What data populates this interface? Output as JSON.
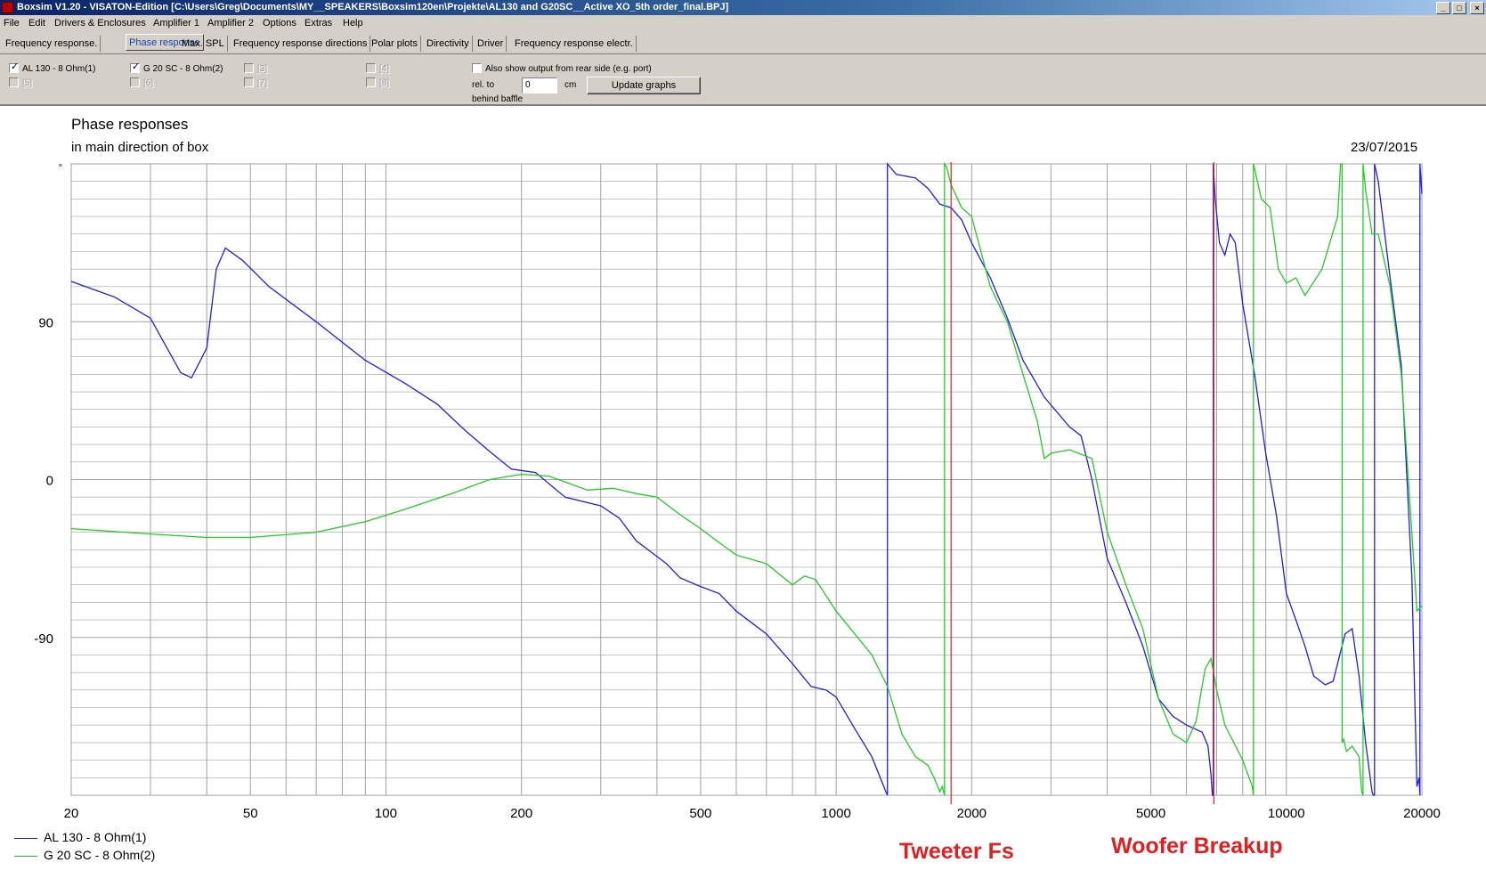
{
  "window": {
    "title": "Boxsim V1.20 - VISATON-Edition [C:\\Users\\Greg\\Documents\\MY__SPEAKERS\\Boxsim120en\\Projekte\\AL130 and G20SC__Active XO_5th order_final.BPJ]",
    "minimize": "_",
    "maximize": "□",
    "close": "×"
  },
  "menu": [
    "File",
    "Edit",
    "Drivers & Enclosures",
    "Amplifier 1",
    "Amplifier 2",
    "Options",
    "Extras",
    "Help"
  ],
  "tabs": [
    "Frequency response.",
    "Phase response",
    "Max. SPL",
    "Frequency response directions",
    "Polar plots",
    "Directivity",
    "Driver",
    "Frequency response electr."
  ],
  "active_tab": "Phase response",
  "drivers": [
    {
      "label": "AL 130 - 8 Ohm(1)",
      "checked": true,
      "enabled": true
    },
    {
      "label": "G 20 SC - 8 Ohm(2)",
      "checked": true,
      "enabled": true
    },
    {
      "label": "[3]",
      "checked": false,
      "enabled": false
    },
    {
      "label": "[4]",
      "checked": false,
      "enabled": false
    },
    {
      "label": "[5]",
      "checked": false,
      "enabled": false
    },
    {
      "label": "[6]",
      "checked": false,
      "enabled": false
    },
    {
      "label": "[7]",
      "checked": false,
      "enabled": false
    },
    {
      "label": "[8]",
      "checked": false,
      "enabled": false
    }
  ],
  "options": {
    "rear_side_label": "Also show output from rear side (e.g. port)",
    "rel_to": "rel. to",
    "behind_baffle": "behind baffle",
    "offset_value": "0",
    "unit": "cm",
    "update_button": "Update graphs"
  },
  "colors": {
    "series1": "#1f1fe0",
    "series2": "#22cc22",
    "annotation": "#e02020",
    "grid": "#a0a0a0"
  },
  "annotations": {
    "tweeter": "Tweeter Fs",
    "woofer": "Woofer Breakup"
  },
  "chart_data": {
    "type": "line",
    "title": "Phase responses",
    "subtitle": "in main direction of box",
    "date": "23/07/2015",
    "x_scale": "log",
    "xlim": [
      20,
      20000
    ],
    "ylim": [
      -180,
      180
    ],
    "y_unit_symbol": "°",
    "x_tick_labels": [
      "20",
      "50",
      "100",
      "200",
      "500",
      "1000",
      "2000",
      "5000",
      "10000",
      "20000"
    ],
    "x_tick_values": [
      20,
      50,
      100,
      200,
      500,
      1000,
      2000,
      5000,
      10000,
      20000
    ],
    "y_tick_labels": [
      "90",
      "0",
      "-90"
    ],
    "y_tick_values": [
      90,
      0,
      -90
    ],
    "grid": true,
    "legend": "bottom-left",
    "vertical_markers": [
      {
        "label": "Tweeter Fs",
        "x": 1800
      },
      {
        "label": "Woofer Breakup",
        "x": 6900
      }
    ],
    "series": [
      {
        "name": "AL 130 - 8 Ohm(1)",
        "color": "#1f1fe0",
        "points": [
          [
            20,
            113
          ],
          [
            25,
            104
          ],
          [
            30,
            92
          ],
          [
            35,
            61
          ],
          [
            37,
            58
          ],
          [
            40,
            75
          ],
          [
            42,
            120
          ],
          [
            44,
            132
          ],
          [
            48,
            125
          ],
          [
            55,
            110
          ],
          [
            70,
            90
          ],
          [
            90,
            68
          ],
          [
            110,
            55
          ],
          [
            130,
            43
          ],
          [
            150,
            28
          ],
          [
            170,
            16
          ],
          [
            190,
            6
          ],
          [
            215,
            4
          ],
          [
            250,
            -10
          ],
          [
            300,
            -15
          ],
          [
            330,
            -22
          ],
          [
            360,
            -35
          ],
          [
            420,
            -48
          ],
          [
            450,
            -56
          ],
          [
            500,
            -61
          ],
          [
            550,
            -65
          ],
          [
            600,
            -75
          ],
          [
            700,
            -88
          ],
          [
            800,
            -105
          ],
          [
            880,
            -118
          ],
          [
            950,
            -120
          ],
          [
            1000,
            -124
          ],
          [
            1100,
            -142
          ],
          [
            1200,
            -158
          ],
          [
            1290,
            -178
          ],
          [
            1300,
            180
          ],
          [
            1360,
            174
          ],
          [
            1500,
            172
          ],
          [
            1600,
            166
          ],
          [
            1700,
            157
          ],
          [
            1800,
            155
          ],
          [
            1900,
            148
          ],
          [
            2000,
            135
          ],
          [
            2200,
            115
          ],
          [
            2400,
            92
          ],
          [
            2600,
            68
          ],
          [
            2900,
            47
          ],
          [
            3300,
            30
          ],
          [
            3500,
            25
          ],
          [
            3700,
            0
          ],
          [
            4000,
            -45
          ],
          [
            4400,
            -70
          ],
          [
            4800,
            -95
          ],
          [
            5200,
            -125
          ],
          [
            5600,
            -135
          ],
          [
            6000,
            -140
          ],
          [
            6500,
            -144
          ],
          [
            6700,
            -152
          ],
          [
            6800,
            -168
          ],
          [
            6850,
            -180
          ],
          [
            6880,
            180
          ],
          [
            6950,
            160
          ],
          [
            7100,
            135
          ],
          [
            7300,
            128
          ],
          [
            7500,
            140
          ],
          [
            7700,
            135
          ],
          [
            8000,
            100
          ],
          [
            8500,
            60
          ],
          [
            9000,
            15
          ],
          [
            9500,
            -20
          ],
          [
            10000,
            -65
          ],
          [
            10500,
            -80
          ],
          [
            11000,
            -95
          ],
          [
            11500,
            -112
          ],
          [
            12200,
            -117
          ],
          [
            12700,
            -115
          ],
          [
            13500,
            -88
          ],
          [
            14000,
            -85
          ],
          [
            14500,
            -112
          ],
          [
            15000,
            -150
          ],
          [
            15500,
            -178
          ],
          [
            15600,
            -180
          ],
          [
            15700,
            180
          ],
          [
            16000,
            170
          ],
          [
            17000,
            115
          ],
          [
            18000,
            65
          ],
          [
            19000,
            -55
          ],
          [
            19500,
            -175
          ],
          [
            19700,
            -170
          ],
          [
            19800,
            180
          ],
          [
            20000,
            163
          ]
        ]
      },
      {
        "name": "G 20 SC - 8 Ohm(2)",
        "color": "#22cc22",
        "points": [
          [
            20,
            -28
          ],
          [
            30,
            -31
          ],
          [
            40,
            -33
          ],
          [
            50,
            -33
          ],
          [
            70,
            -30
          ],
          [
            90,
            -24
          ],
          [
            110,
            -17
          ],
          [
            140,
            -8
          ],
          [
            170,
            0
          ],
          [
            200,
            3
          ],
          [
            230,
            2
          ],
          [
            280,
            -6
          ],
          [
            320,
            -5
          ],
          [
            360,
            -8
          ],
          [
            400,
            -10
          ],
          [
            450,
            -20
          ],
          [
            500,
            -28
          ],
          [
            550,
            -36
          ],
          [
            600,
            -43
          ],
          [
            700,
            -48
          ],
          [
            800,
            -60
          ],
          [
            850,
            -55
          ],
          [
            900,
            -57
          ],
          [
            1000,
            -75
          ],
          [
            1100,
            -88
          ],
          [
            1200,
            -100
          ],
          [
            1300,
            -118
          ],
          [
            1400,
            -145
          ],
          [
            1500,
            -158
          ],
          [
            1600,
            -163
          ],
          [
            1650,
            -170
          ],
          [
            1700,
            -178
          ],
          [
            1720,
            -175
          ],
          [
            1740,
            180
          ],
          [
            1760,
            178
          ],
          [
            1800,
            168
          ],
          [
            1900,
            155
          ],
          [
            2000,
            150
          ],
          [
            2200,
            110
          ],
          [
            2400,
            90
          ],
          [
            2600,
            60
          ],
          [
            2800,
            33
          ],
          [
            2900,
            12
          ],
          [
            3000,
            15
          ],
          [
            3300,
            17
          ],
          [
            3700,
            12
          ],
          [
            4000,
            -30
          ],
          [
            4400,
            -60
          ],
          [
            4800,
            -85
          ],
          [
            5200,
            -125
          ],
          [
            5600,
            -145
          ],
          [
            6000,
            -150
          ],
          [
            6300,
            -138
          ],
          [
            6600,
            -108
          ],
          [
            6800,
            -102
          ],
          [
            7000,
            -120
          ],
          [
            7300,
            -140
          ],
          [
            8000,
            -160
          ],
          [
            8400,
            -175
          ],
          [
            8450,
            180
          ],
          [
            8800,
            160
          ],
          [
            9200,
            155
          ],
          [
            9600,
            120
          ],
          [
            10000,
            112
          ],
          [
            10500,
            115
          ],
          [
            11000,
            105
          ],
          [
            12000,
            120
          ],
          [
            13000,
            150
          ],
          [
            13200,
            180
          ],
          [
            13300,
            -150
          ],
          [
            13400,
            -148
          ],
          [
            13600,
            -155
          ],
          [
            14000,
            -152
          ],
          [
            14500,
            -158
          ],
          [
            14700,
            -178
          ],
          [
            14800,
            180
          ],
          [
            15000,
            165
          ],
          [
            15500,
            140
          ],
          [
            16000,
            140
          ],
          [
            17000,
            110
          ],
          [
            18000,
            60
          ],
          [
            19000,
            -30
          ],
          [
            19500,
            -75
          ],
          [
            20000,
            -72
          ]
        ]
      }
    ]
  }
}
